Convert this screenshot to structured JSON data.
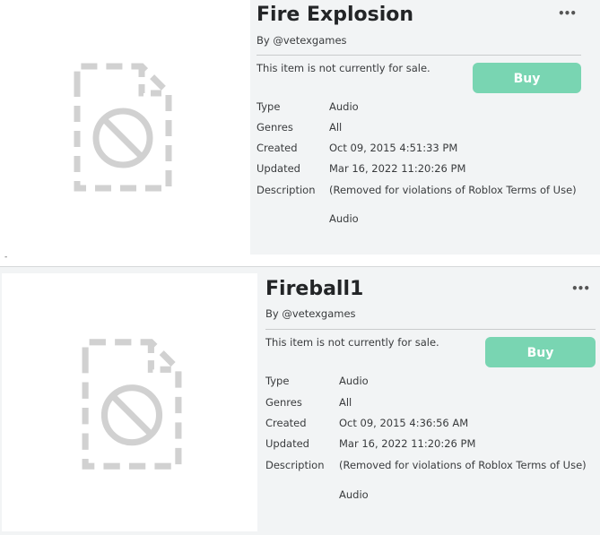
{
  "items": [
    {
      "title": "Fire Explosion",
      "byline": "By @vetexgames",
      "sale_status": "This item is not currently for sale.",
      "buy_label": "Buy",
      "more_label": "•••",
      "details": {
        "type_label": "Type",
        "type_value": "Audio",
        "genres_label": "Genres",
        "genres_value": "All",
        "created_label": "Created",
        "created_value": "Oct 09, 2015 4:51:33 PM",
        "updated_label": "Updated",
        "updated_value": "Mar 16, 2022 11:20:26 PM",
        "description_label": "Description",
        "description_value": "(Removed for violations of Roblox Terms of Use)",
        "extra_value": "Audio"
      }
    },
    {
      "title": "Fireball1",
      "byline": "By @vetexgames",
      "sale_status": "This item is not currently for sale.",
      "buy_label": "Buy",
      "more_label": "•••",
      "details": {
        "type_label": "Type",
        "type_value": "Audio",
        "genres_label": "Genres",
        "genres_value": "All",
        "created_label": "Created",
        "created_value": "Oct 09, 2015 4:36:56 AM",
        "updated_label": "Updated",
        "updated_value": "Mar 16, 2022 11:20:26 PM",
        "description_label": "Description",
        "description_value": "(Removed for violations of Roblox Terms of Use)",
        "extra_value": "Audio"
      }
    }
  ],
  "separator_text": "-",
  "colors": {
    "buy_button": "#79d5b2",
    "page_bg": "#f2f4f5",
    "thumb_bg": "#ffffff",
    "icon_gray": "#d1d1d1"
  },
  "icons": {
    "thumbnail": "blocked-file-icon",
    "menu": "more-options-icon"
  }
}
